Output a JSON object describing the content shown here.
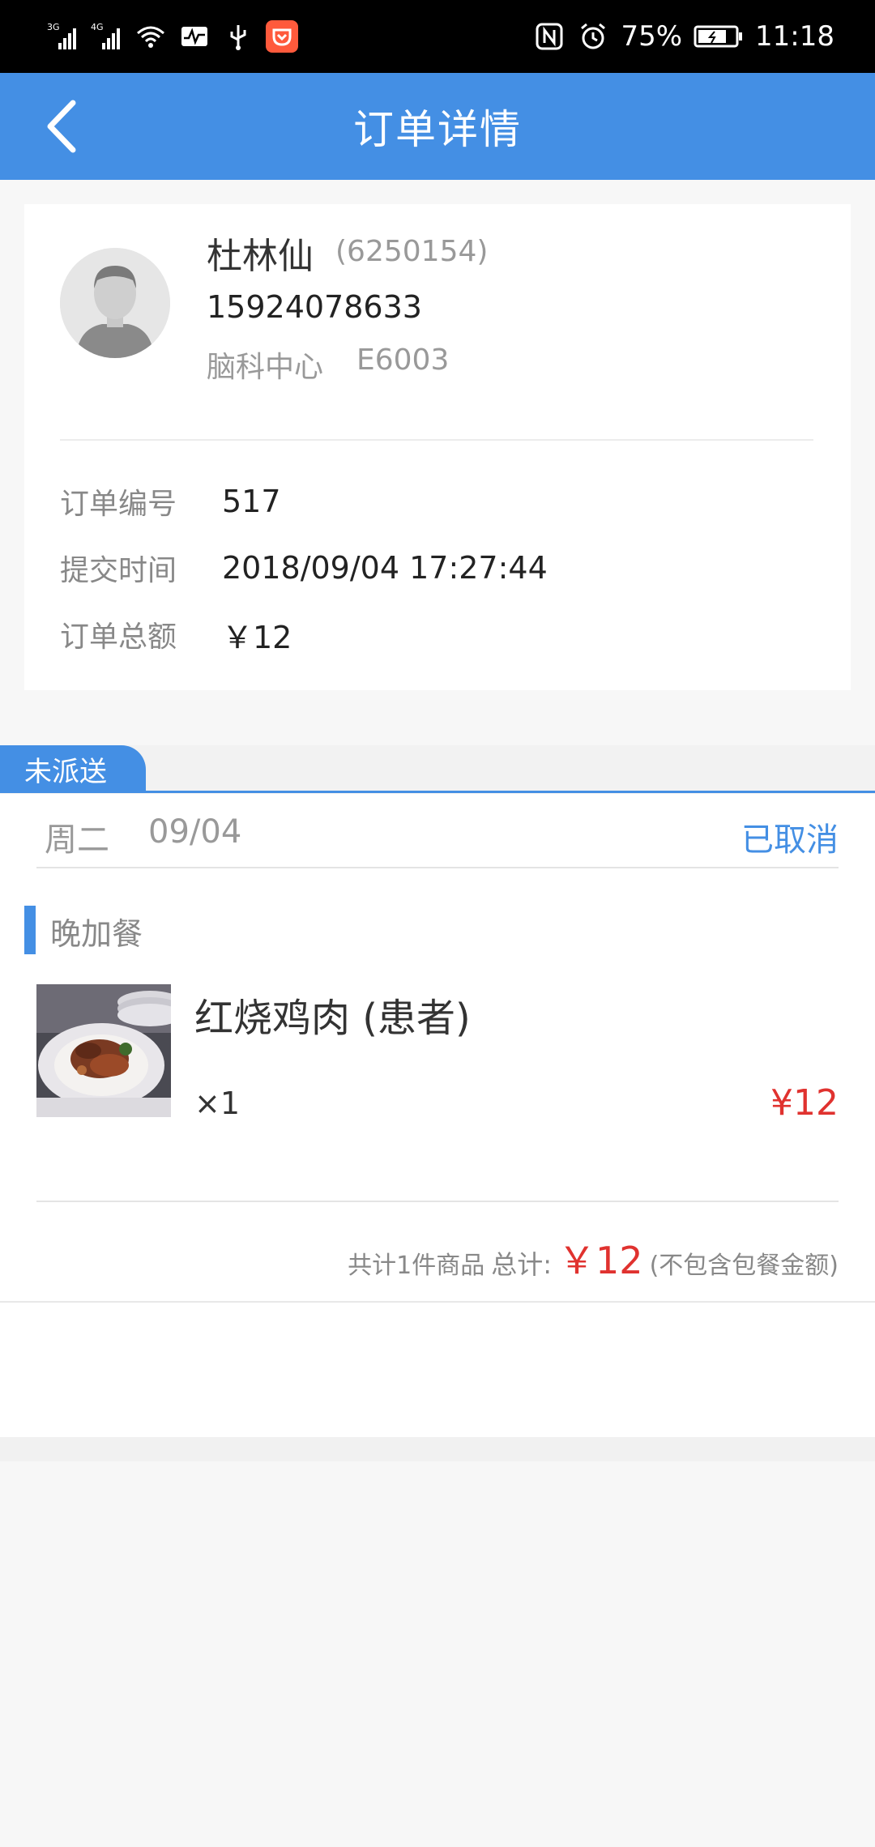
{
  "status_bar": {
    "signal_labels": [
      "3G",
      "4G"
    ],
    "battery": "75%",
    "time": "11:18"
  },
  "header": {
    "title": "订单详情",
    "back_icon": "chevron-left-icon"
  },
  "patient": {
    "name": "杜林仙",
    "id": "(6250154)",
    "phone": "15924078633",
    "department": "脑科中心",
    "bed": "E6003"
  },
  "order_info": [
    {
      "label": "订单编号",
      "value": "517"
    },
    {
      "label": "提交时间",
      "value": "2018/09/04 17:27:44"
    },
    {
      "label": "订单总额",
      "value": "￥12"
    }
  ],
  "order_tab": {
    "label": "未派送"
  },
  "date": {
    "weekday": "周二",
    "date": "09/04",
    "status": "已取消"
  },
  "meal": {
    "type": "晚加餐",
    "items": [
      {
        "name": "红烧鸡肉 (患者)",
        "qty": "×1",
        "price": "¥12"
      }
    ]
  },
  "summary": {
    "count": "共计1件商品",
    "label": "总计:",
    "amount": "￥12",
    "note": "(不包含包餐金额)"
  },
  "colors": {
    "accent": "#448fe4",
    "price": "#e0322f"
  }
}
